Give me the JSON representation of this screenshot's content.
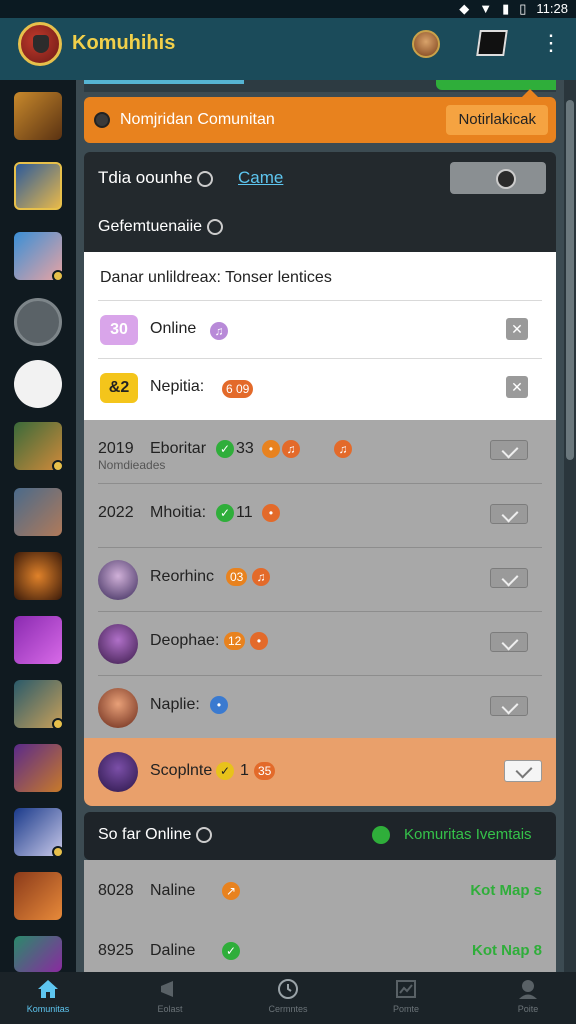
{
  "status": {
    "time": "11:28"
  },
  "appbar": {
    "title": "Komuhihis"
  },
  "banner": {
    "text": "Nomjridan Comunitan",
    "button": "Notirlakicak"
  },
  "card": {
    "title": "Tdia oounhe",
    "link": "Came",
    "subtitle": "Gefemtuenaiie"
  },
  "white_card": {
    "heading": "Danar unlildreax: Tonser lentices",
    "rows": [
      {
        "pill": "30",
        "label": "Online",
        "pill_color": "#d9a5ea",
        "pill_text": "#fff"
      },
      {
        "pill": "&2",
        "label": "Nepitia:",
        "badge": "6 09",
        "pill_color": "#f4c51b",
        "pill_text": "#222"
      }
    ]
  },
  "list": [
    {
      "year": "2019",
      "name": "Eboritar",
      "num": "33",
      "sub": "Nomdieades"
    },
    {
      "year": "2022",
      "name": "Mhoitia:",
      "num": "11"
    },
    {
      "name": "Reorhinc",
      "badge": "03"
    },
    {
      "name": "Deophae:",
      "badge": "12"
    },
    {
      "name": "Naplie:"
    }
  ],
  "orange_row": {
    "name": "Scoplnte",
    "num": "1",
    "badge": "35"
  },
  "sofar": {
    "title": "So far Online",
    "status": "Komuritas Ivemtais"
  },
  "bottom_list": [
    {
      "year": "8028",
      "name": "Naline",
      "right": "Kot Map s"
    },
    {
      "year": "8925",
      "name": "Daline",
      "right": "Kot Nap 8"
    }
  ],
  "nav": [
    "Komunitas",
    "Eolast",
    "Cermntes",
    "Pomte",
    "Poite"
  ],
  "colors": {
    "accent": "#e8821e",
    "appbar": "#1b4b5a",
    "link": "#5ec6f0",
    "online_green": "#2fae3a"
  }
}
